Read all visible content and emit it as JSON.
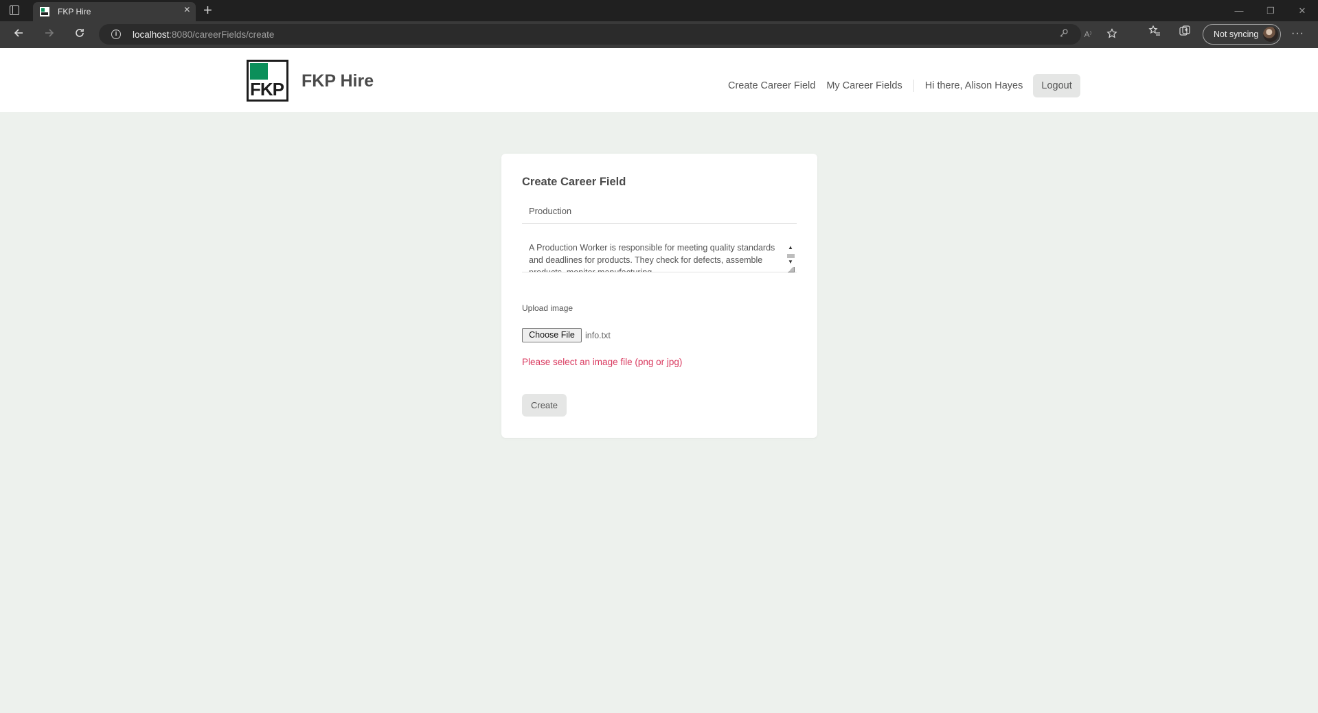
{
  "browser": {
    "tab_title": "FKP Hire",
    "tab_close": "×",
    "new_tab": "+",
    "url_host": "localhost",
    "url_path": ":8080/careerFields/create",
    "sync_label": "Not syncing",
    "more": "···",
    "icons": [
      "back-icon",
      "forward-icon",
      "refresh-icon",
      "info-icon",
      "key-icon",
      "read-aloud-icon",
      "add-favorite-icon",
      "favorites-icon",
      "collections-icon",
      "profile-icon",
      "more-icon"
    ],
    "window_controls": {
      "minimize": "—",
      "restore": "❐",
      "close": "✕"
    }
  },
  "header": {
    "brand": "FKP Hire",
    "logo_text": "FKP",
    "logo_color": "#0b8f5a",
    "nav": {
      "create_career_field": "Create Career Field",
      "my_career_fields": "My Career Fields",
      "greeting": "Hi there, Alison Hayes",
      "logout": "Logout"
    }
  },
  "form": {
    "title": "Create Career Field",
    "name_value": "Production",
    "description_value": "A Production Worker is responsible for meeting quality standards and deadlines for products. They check for defects, assemble products, monitor manufacturing",
    "upload_label": "Upload image",
    "choose_file_label": "Choose File",
    "file_name": "info.txt",
    "error": "Please select an image file (png or jpg)",
    "error_color": "#d9385e",
    "submit_label": "Create"
  }
}
